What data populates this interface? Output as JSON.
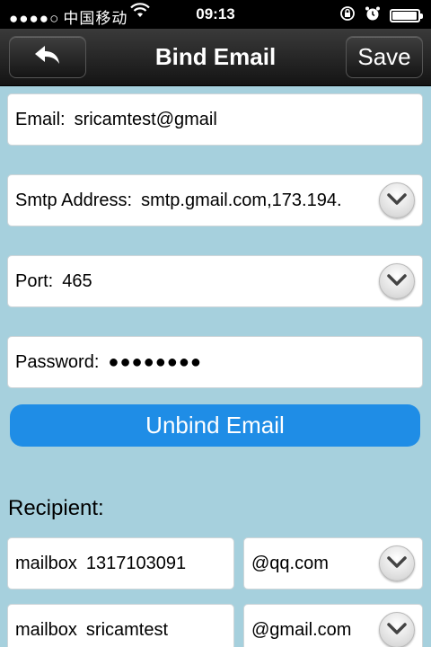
{
  "status_bar": {
    "signal": "●●●●○",
    "carrier": "中国移动",
    "time": "09:13",
    "battery_level": 0.95
  },
  "nav": {
    "title": "Bind Email",
    "save_label": "Save"
  },
  "form": {
    "email": {
      "label": "Email:",
      "value": "sricamtest@gmail"
    },
    "smtp": {
      "label": "Smtp Address:",
      "value": "smtp.gmail.com,173.194."
    },
    "port": {
      "label": "Port:",
      "value": "465"
    },
    "password": {
      "label": "Password:",
      "value": "●●●●●●●●"
    }
  },
  "unbind_label": "Unbind Email",
  "recipient": {
    "label": "Recipient:",
    "rows": [
      {
        "label": "mailbox",
        "value": "1317103091",
        "domain": "@qq.com"
      },
      {
        "label": "mailbox",
        "value": "sricamtest",
        "domain": "@gmail.com"
      }
    ]
  },
  "icons": {
    "back": "back-arrow-icon",
    "dropdown": "chevron-down-icon"
  }
}
